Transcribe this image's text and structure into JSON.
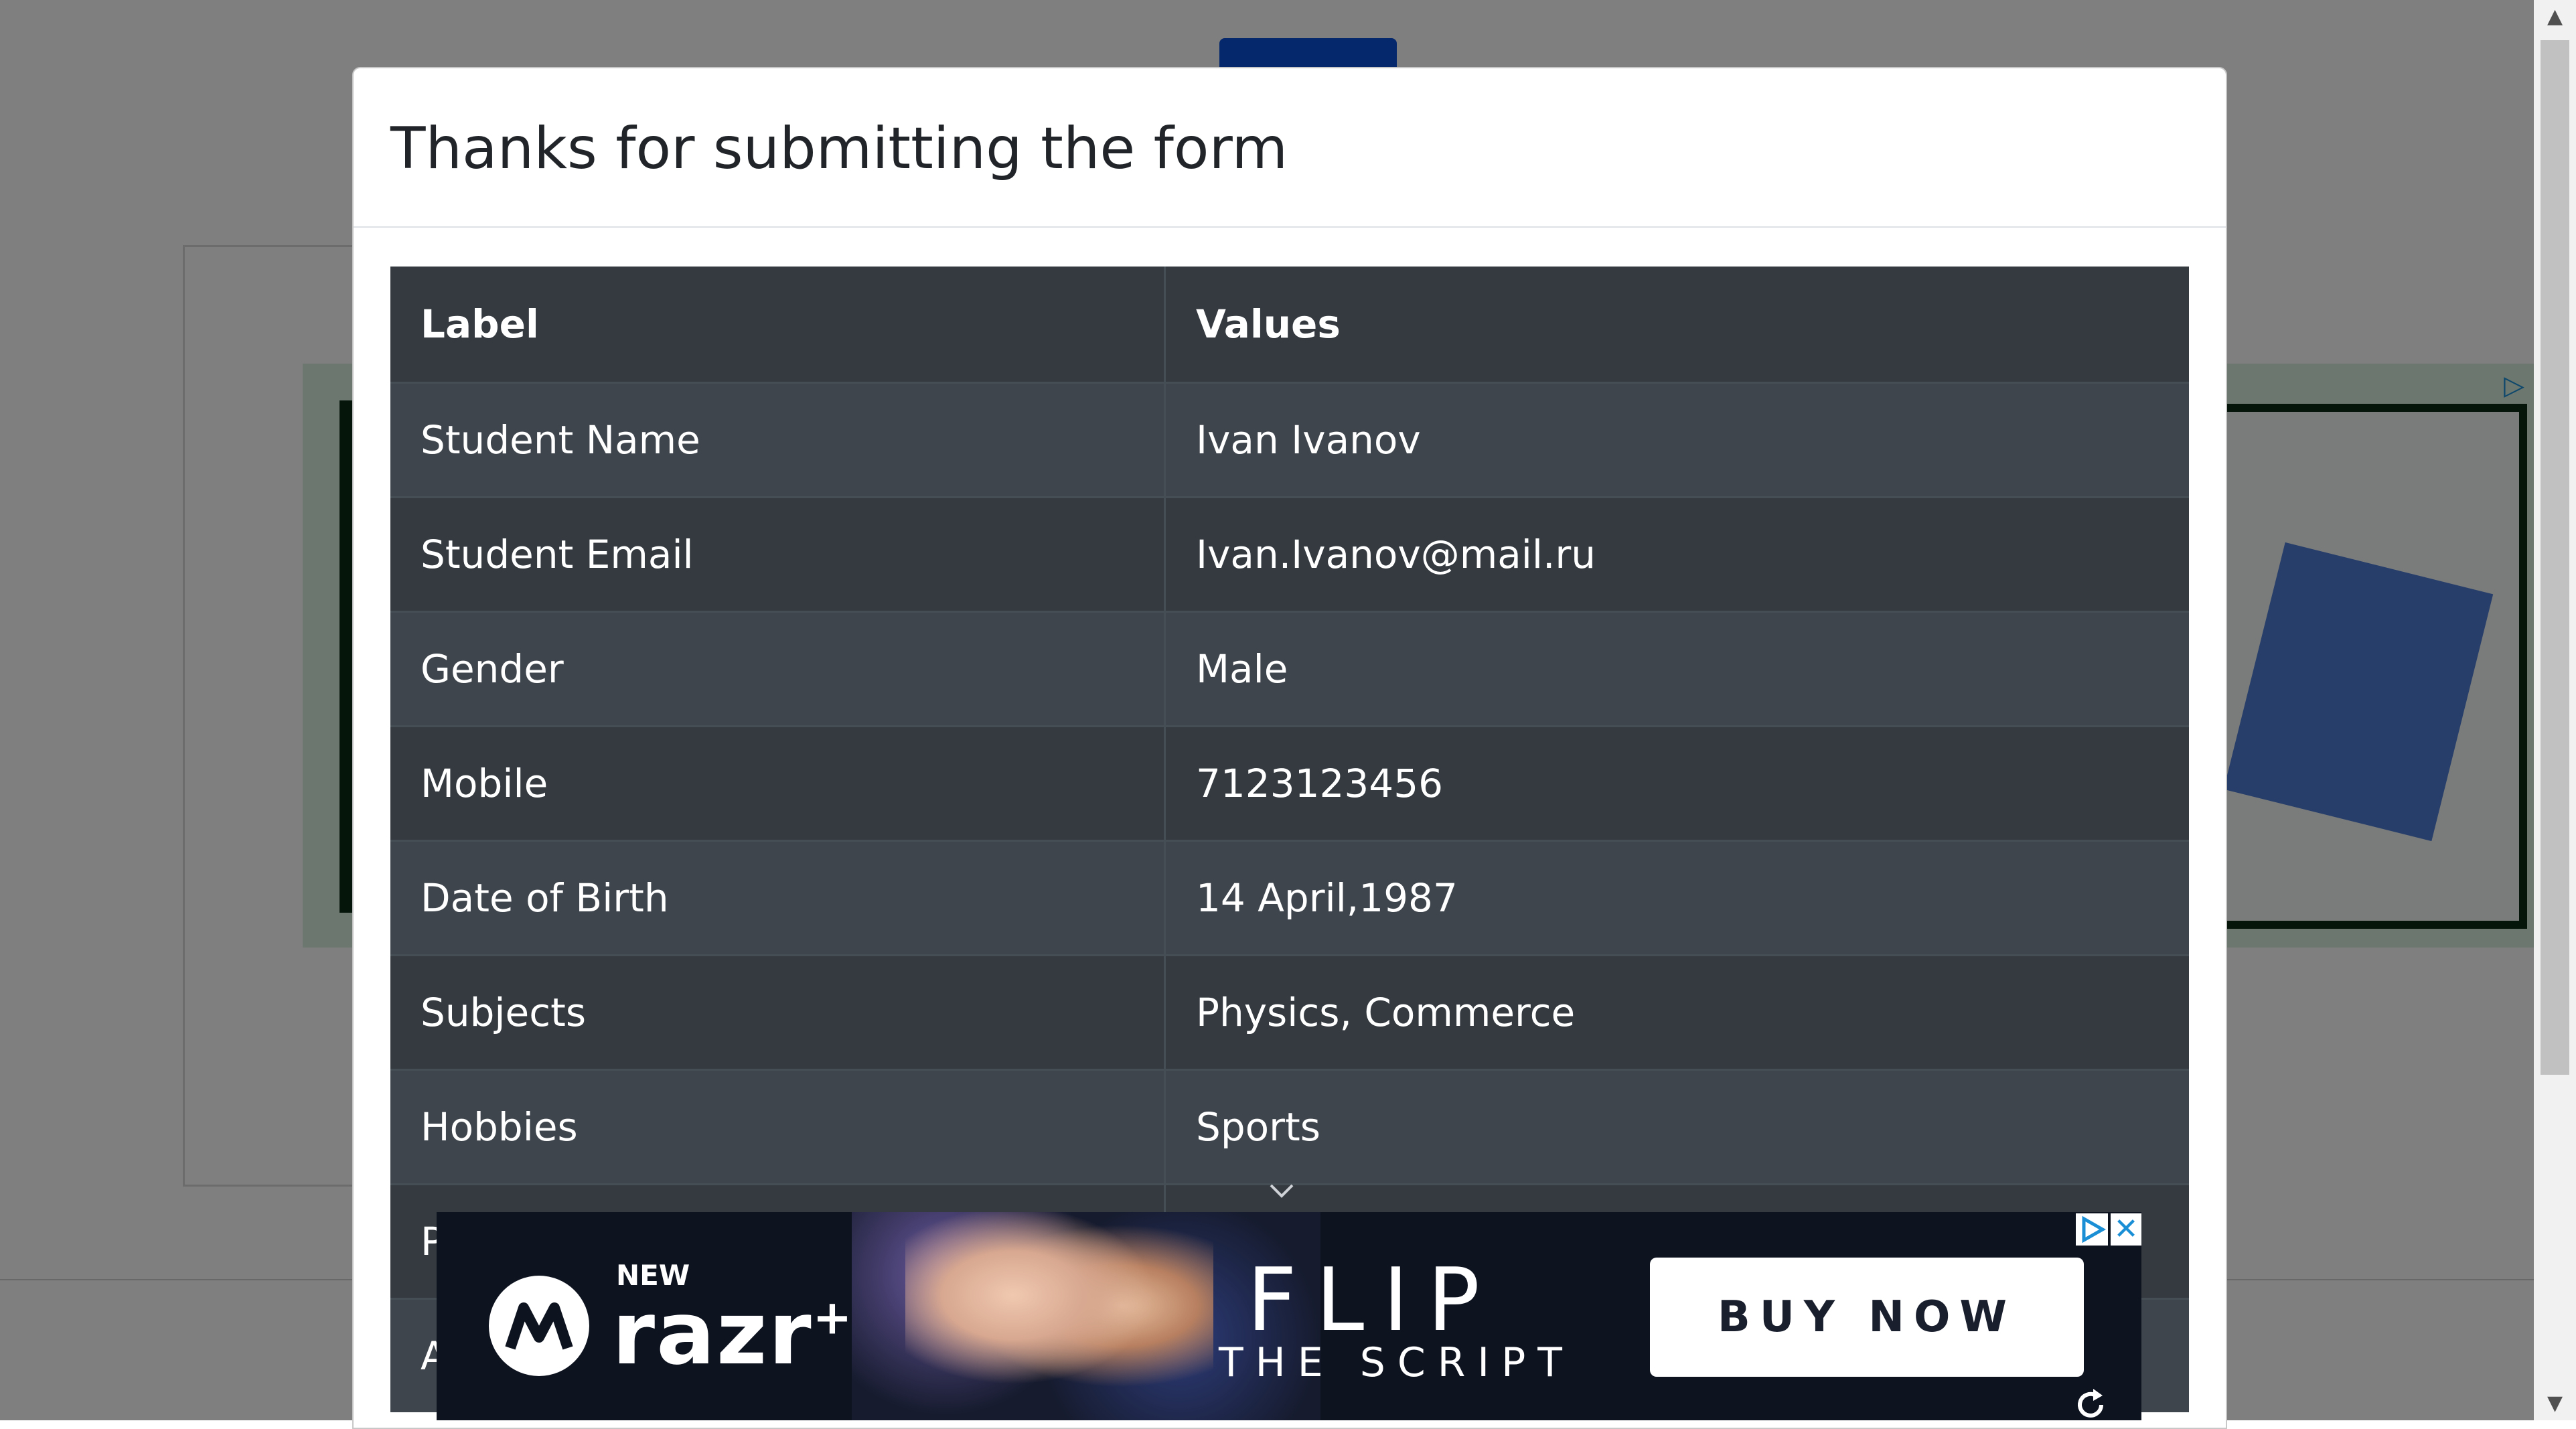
{
  "modal": {
    "title": "Thanks for submitting the form"
  },
  "table": {
    "headers": [
      "Label",
      "Values"
    ],
    "rows": [
      {
        "label": "Student Name",
        "value": "Ivan Ivanov"
      },
      {
        "label": "Student Email",
        "value": "Ivan.Ivanov@mail.ru"
      },
      {
        "label": "Gender",
        "value": "Male"
      },
      {
        "label": "Mobile",
        "value": "7123123456"
      },
      {
        "label": "Date of Birth",
        "value": "14 April,1987"
      },
      {
        "label": "Subjects",
        "value": "Physics, Commerce"
      },
      {
        "label": "Hobbies",
        "value": "Sports"
      },
      {
        "label": "P",
        "value": ""
      },
      {
        "label": "A",
        "value": ""
      }
    ]
  },
  "ad": {
    "new_label": "NEW",
    "brand": "razr",
    "brand_sup": "+",
    "headline": "FLIP",
    "subline": "THE SCRIPT",
    "cta": "BUY NOW",
    "close": "✕"
  },
  "colors": {
    "table_bg": "#343a40",
    "table_stripe": "#3f454c",
    "table_border": "#454d55",
    "ad_bg": "#0e1320",
    "adchoices_blue": "#1b8fd6"
  }
}
